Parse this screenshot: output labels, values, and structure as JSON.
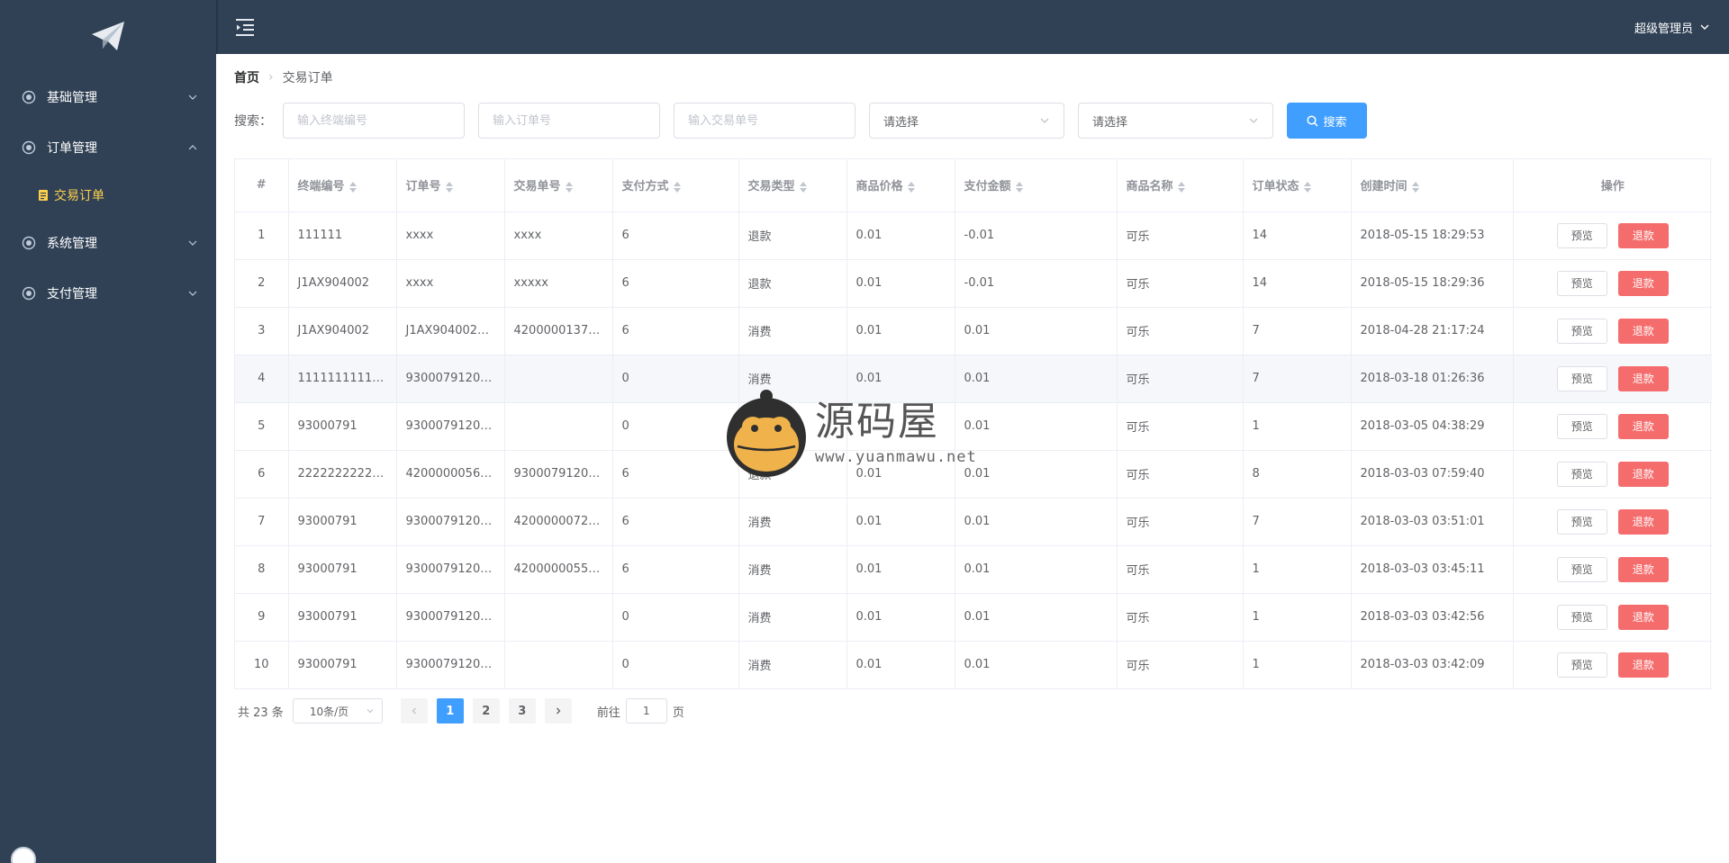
{
  "sidebar": {
    "logo_icon": "paper-plane-icon",
    "menus": [
      {
        "label": "基础管理",
        "icon": "gear-icon",
        "expanded": false
      },
      {
        "label": "订单管理",
        "icon": "gear-icon",
        "expanded": true,
        "children": [
          {
            "label": "交易订单",
            "icon": "document-icon",
            "active": true
          }
        ]
      },
      {
        "label": "系统管理",
        "icon": "gear-icon",
        "expanded": false
      },
      {
        "label": "支付管理",
        "icon": "gear-icon",
        "expanded": false
      }
    ]
  },
  "header": {
    "user": "超级管理员"
  },
  "breadcrumb": {
    "home": "首页",
    "current": "交易订单"
  },
  "search": {
    "label": "搜索：",
    "terminal_placeholder": "输入终端编号",
    "order_placeholder": "输入订单号",
    "trade_placeholder": "输入交易单号",
    "select1": "请选择",
    "select2": "请选择",
    "button": "搜索"
  },
  "table": {
    "headers": [
      "#",
      "终端编号",
      "订单号",
      "交易单号",
      "支付方式",
      "交易类型",
      "商品价格",
      "支付金额",
      "商品名称",
      "订单状态",
      "创建时间",
      "操作"
    ],
    "preview_label": "预览",
    "refund_label": "退款",
    "rows": [
      [
        "1",
        "111111",
        "xxxx",
        "xxxx",
        "6",
        "退款",
        "0.01",
        "-0.01",
        "可乐",
        "14",
        "2018-05-15 18:29:53"
      ],
      [
        "2",
        "J1AX904002",
        "xxxx",
        "xxxxx",
        "6",
        "退款",
        "0.01",
        "-0.01",
        "可乐",
        "14",
        "2018-05-15 18:29:36"
      ],
      [
        "3",
        "J1AX904002",
        "J1AX904002…",
        "4200000137…",
        "6",
        "消费",
        "0.01",
        "0.01",
        "可乐",
        "7",
        "2018-04-28 21:17:24"
      ],
      [
        "4",
        "111111111111…",
        "9300079120…",
        "",
        "0",
        "消费",
        "0.01",
        "0.01",
        "可乐",
        "7",
        "2018-03-18 01:26:36"
      ],
      [
        "5",
        "93000791",
        "9300079120…",
        "",
        "0",
        "",
        "",
        "0.01",
        "可乐",
        "1",
        "2018-03-05 04:38:29"
      ],
      [
        "6",
        "2222222222…",
        "4200000056…",
        "9300079120…",
        "6",
        "退款",
        "0.01",
        "0.01",
        "可乐",
        "8",
        "2018-03-03 07:59:40"
      ],
      [
        "7",
        "93000791",
        "9300079120…",
        "4200000072…",
        "6",
        "消费",
        "0.01",
        "0.01",
        "可乐",
        "7",
        "2018-03-03 03:51:01"
      ],
      [
        "8",
        "93000791",
        "9300079120…",
        "4200000055…",
        "6",
        "消费",
        "0.01",
        "0.01",
        "可乐",
        "1",
        "2018-03-03 03:45:11"
      ],
      [
        "9",
        "93000791",
        "9300079120…",
        "",
        "0",
        "消费",
        "0.01",
        "0.01",
        "可乐",
        "1",
        "2018-03-03 03:42:56"
      ],
      [
        "10",
        "93000791",
        "9300079120…",
        "",
        "0",
        "消费",
        "0.01",
        "0.01",
        "可乐",
        "1",
        "2018-03-03 03:42:09"
      ]
    ]
  },
  "pagination": {
    "total": "共 23 条",
    "page_size": "10条/页",
    "pages": [
      "1",
      "2",
      "3"
    ],
    "current_page": "1",
    "goto_prefix": "前往",
    "goto_value": "1",
    "goto_suffix": "页"
  },
  "watermark": {
    "title": "源码屋",
    "url": "www.yuanmawu.net"
  }
}
